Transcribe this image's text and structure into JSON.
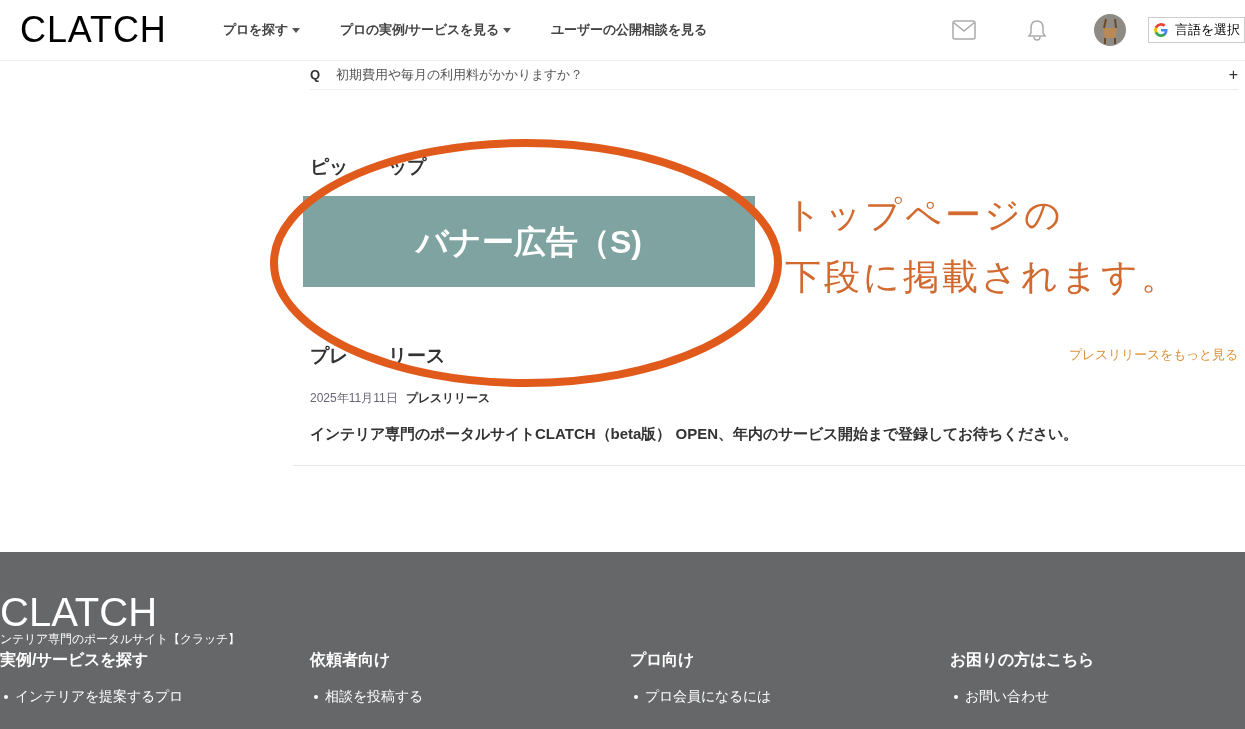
{
  "header": {
    "logo": "CLATCH",
    "nav": [
      {
        "label": "プロを探す",
        "dropdown": true
      },
      {
        "label": "プロの実例/サービスを見る",
        "dropdown": true
      },
      {
        "label": "ユーザーの公開相談を見る",
        "dropdown": false
      }
    ],
    "language_button": "言語を選択"
  },
  "faq": {
    "mark": "Q",
    "question": "初期費用や毎月の利用料がかかりますか？",
    "expand": "+"
  },
  "pickup": {
    "heading_parts": [
      "ピッ",
      "ップ"
    ],
    "banner": "バナー広告（S)"
  },
  "annotation": {
    "lines": [
      "トップページの",
      "下段に掲載されます。"
    ]
  },
  "press": {
    "heading_parts": [
      "プレ",
      "リース"
    ],
    "more_link": "プレスリリースをもっと見る",
    "items": [
      {
        "date": "2025年11月11日",
        "category": "プレスリリース",
        "title": "インテリア専門のポータルサイトCLATCH（beta版） OPEN、年内のサービス開始まで登録してお待ちください。"
      }
    ]
  },
  "footer": {
    "logo": "CLATCH",
    "tagline": "ンテリア専門のポータルサイト【クラッチ】",
    "columns": [
      {
        "heading": "実例/サービスを探す",
        "items": [
          "インテリアを提案するプロ"
        ]
      },
      {
        "heading": "依頼者向け",
        "items": [
          "相談を投稿する"
        ]
      },
      {
        "heading": "プロ向け",
        "items": [
          "プロ会員になるには"
        ]
      },
      {
        "heading": "お困りの方はこちら",
        "items": [
          "お問い合わせ"
        ]
      }
    ]
  }
}
